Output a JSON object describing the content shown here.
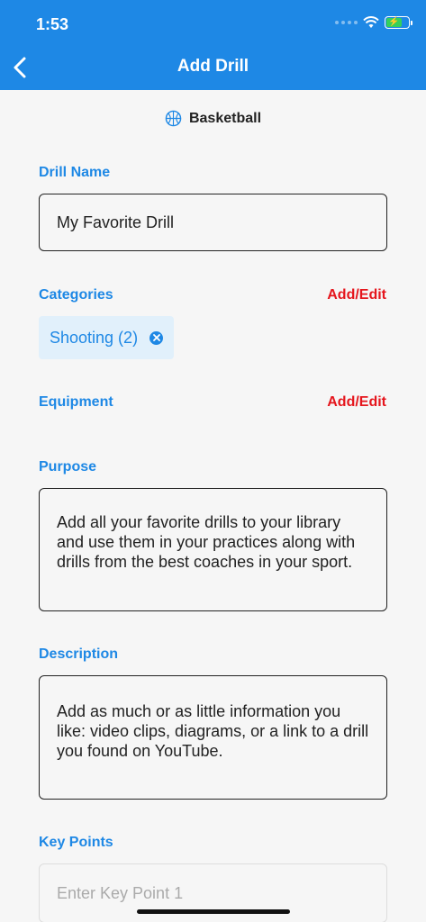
{
  "status_bar": {
    "time": "1:53"
  },
  "header": {
    "title": "Add Drill"
  },
  "sport": {
    "label": "Basketball",
    "icon": "basketball-icon"
  },
  "drill_name": {
    "label": "Drill Name",
    "value": "My Favorite Drill"
  },
  "categories": {
    "label": "Categories",
    "action": "Add/Edit",
    "chips": [
      {
        "label": "Shooting (2)"
      }
    ]
  },
  "equipment": {
    "label": "Equipment",
    "action": "Add/Edit"
  },
  "purpose": {
    "label": "Purpose",
    "value": "Add all your favorite drills to your library and use them in your practices along with drills from the best coaches in your sport."
  },
  "description": {
    "label": "Description",
    "value": "Add as much or as little information you like: video clips, diagrams, or a link to a drill you found on YouTube."
  },
  "key_points": {
    "label": "Key Points",
    "placeholder": "Enter Key Point 1"
  },
  "colors": {
    "primary": "#1e88e5",
    "accent": "#e5161d",
    "background": "#f6f6f6"
  }
}
